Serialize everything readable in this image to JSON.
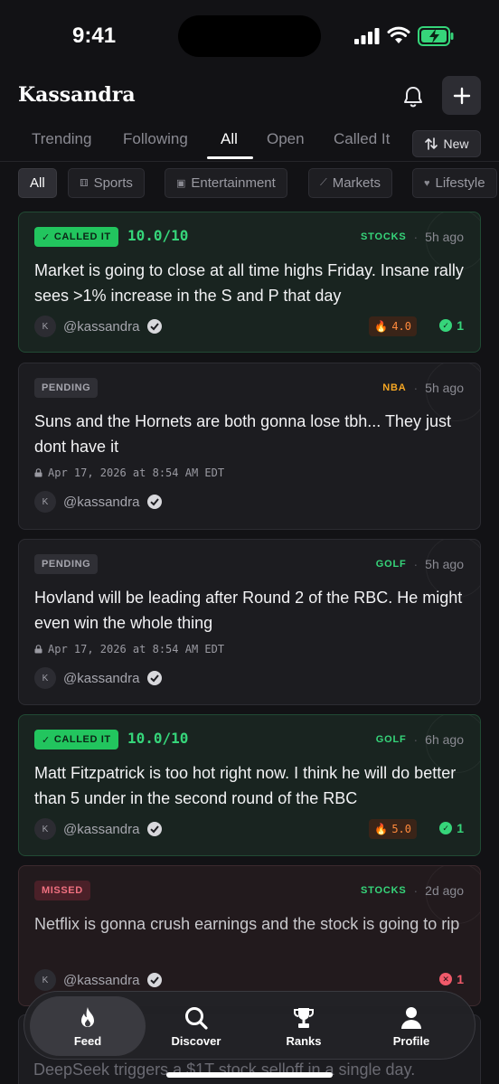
{
  "status_bar": {
    "time": "9:41"
  },
  "header": {
    "title": "Kassandra"
  },
  "tabs": [
    {
      "label": "Trending"
    },
    {
      "label": "Following"
    },
    {
      "label": "All"
    },
    {
      "label": "Open"
    },
    {
      "label": "Called It"
    }
  ],
  "active_tab": "All",
  "sort_button": {
    "label": "New"
  },
  "chips": [
    {
      "label": "All",
      "icon": ""
    },
    {
      "label": "Sports",
      "icon": "sports-icon"
    },
    {
      "label": "Entertainment",
      "icon": "tv-icon"
    },
    {
      "label": "Markets",
      "icon": "chart-icon"
    },
    {
      "label": "Lifestyle",
      "icon": "heart-icon"
    }
  ],
  "cards": [
    {
      "status": "CALLED IT",
      "score": "10.0/10",
      "category": "STOCKS",
      "time": "5h ago",
      "text": "Market is going to close at all time highs Friday. Insane rally sees >1% increase in the S and P that day",
      "author": "@kassandra",
      "avatar_letter": "K",
      "heat": "4.0",
      "result_count": "1"
    },
    {
      "status": "PENDING",
      "category": "NBA",
      "time": "5h ago",
      "text": "Suns and the Hornets are both gonna lose tbh... They just dont have it",
      "deadline": "Apr 17, 2026 at 8:54 AM EDT",
      "author": "@kassandra",
      "avatar_letter": "K"
    },
    {
      "status": "PENDING",
      "category": "GOLF",
      "time": "5h ago",
      "text": "Hovland will be leading after Round 2 of the RBC. He might even win the whole thing",
      "deadline": "Apr 17, 2026 at 8:54 AM EDT",
      "author": "@kassandra",
      "avatar_letter": "K"
    },
    {
      "status": "CALLED IT",
      "score": "10.0/10",
      "category": "GOLF",
      "time": "6h ago",
      "text": "Matt Fitzpatrick is too hot right now. I think he will do better than 5 under in the second round of the RBC",
      "author": "@kassandra",
      "avatar_letter": "K",
      "heat": "5.0",
      "result_count": "1"
    },
    {
      "status": "MISSED",
      "category": "STOCKS",
      "time": "2d ago",
      "text": "Netflix is gonna crush earnings and the stock is going to rip",
      "author": "@kassandra",
      "avatar_letter": "K",
      "result_count": "1"
    }
  ],
  "partial_card": {
    "text": "DeepSeek triggers a $1T stock selloff in a single day."
  },
  "bottom_nav": [
    {
      "label": "Feed"
    },
    {
      "label": "Discover"
    },
    {
      "label": "Ranks"
    },
    {
      "label": "Profile"
    }
  ],
  "colors": {
    "accent_green": "#22c55e",
    "pending_gray": "#2f2f35",
    "missed_red": "#f05a6a",
    "heat_orange": "#ff8a3c",
    "nba_orange": "#f5a623"
  }
}
